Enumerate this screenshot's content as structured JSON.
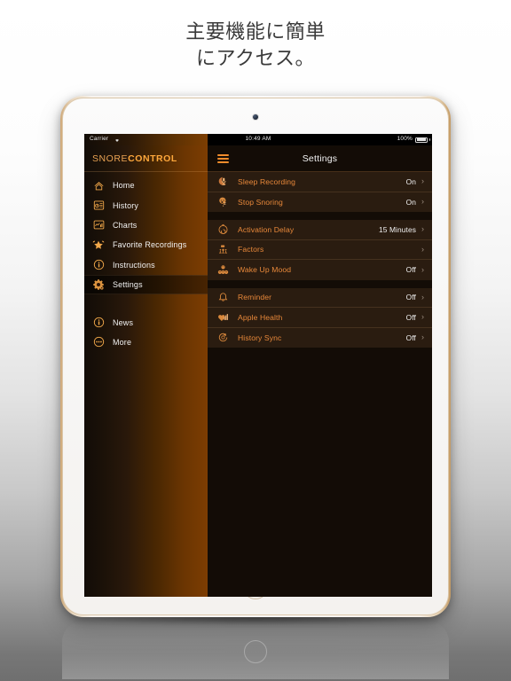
{
  "headline": {
    "line1": "主要機能に簡単",
    "line2": "にアクセス。"
  },
  "device": {
    "name": "ipad-gold",
    "frame_color": "#c49a63",
    "bezel_color": "#fbfafa"
  },
  "statusbar": {
    "carrier": "Carrier",
    "wifi_icon": "wifi-icon",
    "time": "10:49 AM",
    "battery_percent": "100%",
    "battery_icon": "battery-full-icon"
  },
  "sidebar": {
    "brand": {
      "light": "SNORE",
      "bold": "CONTROL"
    },
    "accent": "#ffa83c",
    "items": [
      {
        "label": "Home",
        "icon": "home-icon",
        "selected": false
      },
      {
        "label": "History",
        "icon": "history-icon",
        "selected": false
      },
      {
        "label": "Charts",
        "icon": "charts-icon",
        "selected": false
      },
      {
        "label": "Favorite Recordings",
        "icon": "star-icon",
        "selected": false
      },
      {
        "label": "Instructions",
        "icon": "info-icon",
        "selected": false
      },
      {
        "label": "Settings",
        "icon": "gear-icon",
        "selected": true
      }
    ],
    "secondary_items": [
      {
        "label": "News",
        "icon": "news-icon"
      },
      {
        "label": "More",
        "icon": "more-dots-icon"
      }
    ]
  },
  "panel": {
    "menu_icon": "hamburger-icon",
    "title": "Settings",
    "chevron": "›",
    "groups": [
      {
        "rows": [
          {
            "label": "Sleep Recording",
            "value": "On",
            "icon": "moon-mic-icon"
          },
          {
            "label": "Stop Snoring",
            "value": "On",
            "icon": "sleeping-face-icon"
          }
        ]
      },
      {
        "rows": [
          {
            "label": "Activation Delay",
            "value": "15 Minutes",
            "icon": "timer-icon"
          },
          {
            "label": "Factors",
            "value": "",
            "icon": "factors-icon"
          },
          {
            "label": "Wake Up Mood",
            "value": "Off",
            "icon": "mood-faces-icon"
          }
        ]
      },
      {
        "rows": [
          {
            "label": "Reminder",
            "value": "Off",
            "icon": "bell-icon"
          },
          {
            "label": "Apple Health",
            "value": "Off",
            "icon": "apple-health-icon"
          },
          {
            "label": "History Sync",
            "value": "Off",
            "icon": "sync-icon"
          }
        ]
      }
    ]
  }
}
